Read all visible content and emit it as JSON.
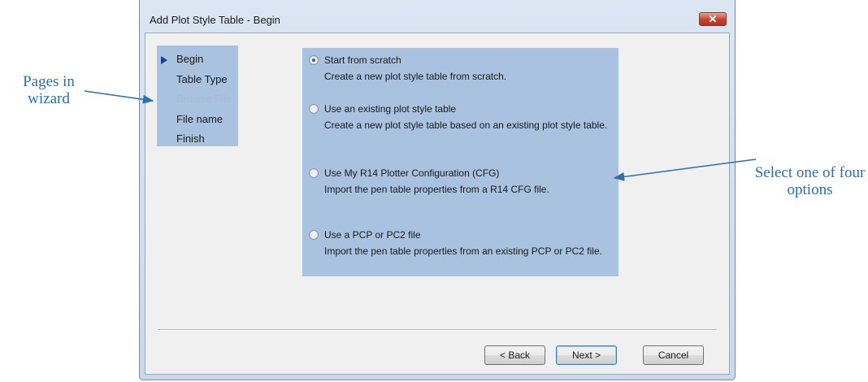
{
  "annotations": {
    "left_callout": "Pages in wizard",
    "right_callout": "Select one of four options"
  },
  "window": {
    "title": "Add Plot Style Table - Begin",
    "close_icon": "close-icon"
  },
  "steps": {
    "current": "Begin",
    "items": [
      {
        "label": "Begin",
        "enabled": true
      },
      {
        "label": "Table Type",
        "enabled": true
      },
      {
        "label": "Browse File",
        "enabled": false
      },
      {
        "label": "File name",
        "enabled": true
      },
      {
        "label": "Finish",
        "enabled": true
      }
    ]
  },
  "options": {
    "selected": "Start from scratch",
    "items": [
      {
        "label": "Start from scratch",
        "description": "Create a new plot style table from scratch."
      },
      {
        "label": "Use an existing plot style table",
        "description": "Create a new plot style table based on an existing plot style table."
      },
      {
        "label": "Use My R14 Plotter Configuration (CFG)",
        "description": "Import the pen table properties from a R14 CFG file."
      },
      {
        "label": "Use a PCP or PC2 file",
        "description": "Import the pen table properties from an existing PCP or PC2 file."
      }
    ]
  },
  "buttons": {
    "back": "< Back",
    "next": "Next >",
    "cancel": "Cancel"
  },
  "colors": {
    "accent_panel": "#a8c2df",
    "callout_text": "#2a6fb0"
  }
}
